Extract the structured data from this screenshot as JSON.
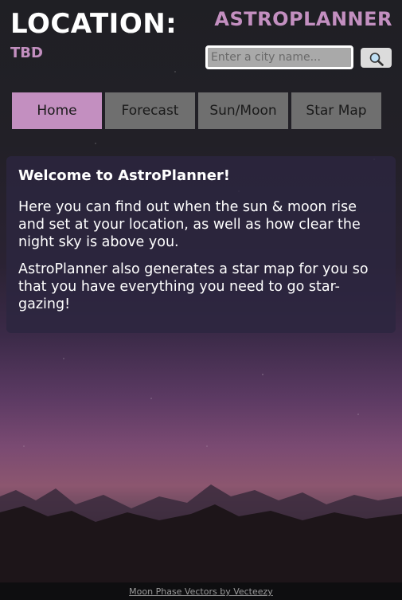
{
  "header": {
    "location_label": "LOCATION:",
    "location_value": "TBD",
    "brand": "ASTROPLANNER"
  },
  "search": {
    "placeholder": "Enter a city name...",
    "value": "",
    "button_icon": "magnifier-icon"
  },
  "nav": {
    "tabs": [
      {
        "label": "Home",
        "active": true
      },
      {
        "label": "Forecast",
        "active": false
      },
      {
        "label": "Sun/Moon",
        "active": false
      },
      {
        "label": "Star Map",
        "active": false
      }
    ]
  },
  "welcome": {
    "title": "Welcome to AstroPlanner!",
    "paragraphs": [
      "Here you can find out when the sun & moon rise and set at your location, as well as how clear the night sky is above you.",
      "AstroPlanner also generates a star map for you so that you have everything you need to go star-gazing!"
    ]
  },
  "footer": {
    "credit_link": "Moon Phase Vectors by Vecteezy"
  },
  "colors": {
    "accent": "#c38fc0",
    "tab_inactive": "#6f6f6f",
    "card_bg": "#2c2640"
  }
}
